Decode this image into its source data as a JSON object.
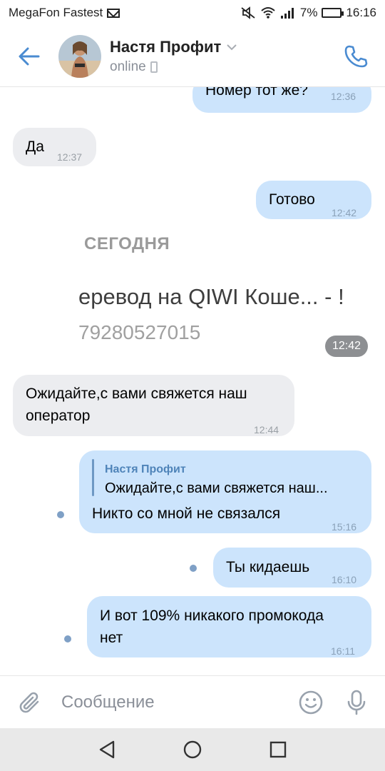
{
  "status_bar": {
    "carrier": "MegaFon Fastest",
    "battery": "7%",
    "time": "16:16",
    "icons": [
      "mail-icon",
      "mute-icon",
      "wifi-icon",
      "signal-icon",
      "battery-icon"
    ]
  },
  "header": {
    "contact_name": "Настя Профит",
    "contact_status": "online",
    "icons": [
      "back-arrow-icon",
      "chevron-down-icon",
      "mobile-icon",
      "phone-icon"
    ]
  },
  "messages": [
    {
      "direction": "out",
      "text": "Номер тот же?",
      "time": "12:36"
    },
    {
      "direction": "in",
      "text": "Да",
      "time": "12:37"
    },
    {
      "direction": "out",
      "text": "Готово",
      "time": "12:42"
    }
  ],
  "screenshot_attachment": {
    "date_label": "СЕГОДНЯ",
    "line1": "еревод на QIWI Коше...  - !",
    "line2": "79280527015",
    "time": "12:42"
  },
  "messages_after": [
    {
      "direction": "in",
      "line1": "Ожидайте,с вами свяжется наш",
      "line2": "оператор",
      "time": "12:44"
    },
    {
      "direction": "out",
      "reply_name": "Настя Профит",
      "reply_text": "Ожидайте,с вами свяжется наш...",
      "text": "Никто со мной не связался",
      "time": "15:16"
    },
    {
      "direction": "out",
      "text": "Ты кидаешь",
      "time": "16:10"
    },
    {
      "direction": "out",
      "line1": "И вот 109% никакого промокода",
      "line2": "нет",
      "time": "16:11"
    }
  ],
  "input_bar": {
    "placeholder": "Сообщение",
    "icons": [
      "paperclip-icon",
      "emoji-icon",
      "microphone-icon"
    ]
  },
  "nav_bar": {
    "icons": [
      "back-triangle-icon",
      "home-circle-icon",
      "recents-square-icon"
    ]
  },
  "colors": {
    "accent": "#4a8bd1",
    "outgoing_bubble": "#cce4fc",
    "incoming_bubble": "#ecedf0",
    "unread_dot": "#7fa0c6"
  }
}
